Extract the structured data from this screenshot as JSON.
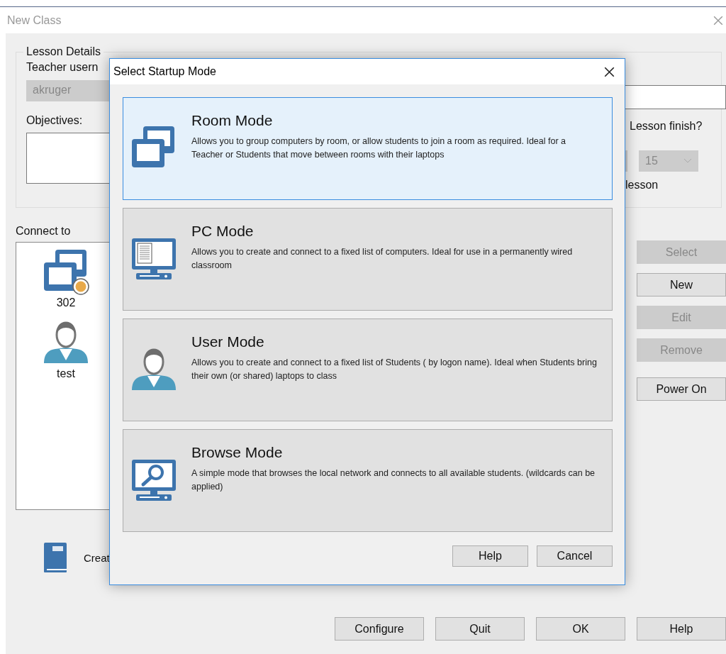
{
  "window": {
    "title": "New Class"
  },
  "lesson_details": {
    "title": "Lesson Details",
    "teacher_username_label": "Teacher usern",
    "teacher_username": {
      "value": "akruger",
      "disabled": true
    },
    "objectives_label": "Objectives:",
    "finish_label": "Lesson finish?",
    "finish_minute": {
      "value": "15",
      "disabled": true
    },
    "finish_note": "lesson"
  },
  "connect_to": {
    "label": "Connect to",
    "items": [
      {
        "kind": "room",
        "label": "302"
      },
      {
        "kind": "user",
        "label": "test"
      }
    ]
  },
  "side_buttons": [
    {
      "label": "Select",
      "disabled": true
    },
    {
      "label": "New",
      "disabled": false
    },
    {
      "label": "Edit",
      "disabled": true
    },
    {
      "label": "Remove",
      "disabled": true
    },
    {
      "label": "Power On",
      "disabled": false
    }
  ],
  "create_label": "Creat",
  "footer_buttons": [
    "Configure",
    "Quit",
    "OK",
    "Help"
  ],
  "dialog": {
    "title": "Select Startup Mode",
    "modes": [
      {
        "kind": "room",
        "title": "Room Mode",
        "description": "Allows you to group computers by room, or allow students to join a room as required. Ideal for a Teacher or Students that move between rooms with their laptops",
        "selected": true
      },
      {
        "kind": "pc",
        "title": "PC Mode",
        "description": "Allows you to create and connect to a fixed list of computers. Ideal for use in a permanently wired classroom",
        "selected": false
      },
      {
        "kind": "user",
        "title": "User Mode",
        "description": "Allows you to create and connect to a fixed list of Students ( by logon name). Ideal when Students bring their own (or shared) laptops to class",
        "selected": false
      },
      {
        "kind": "browse",
        "title": "Browse Mode",
        "description": "A simple mode that browses the local network and connects to all available students. (wildcards can be applied)",
        "selected": false
      }
    ],
    "buttons": [
      "Help",
      "Cancel"
    ]
  }
}
